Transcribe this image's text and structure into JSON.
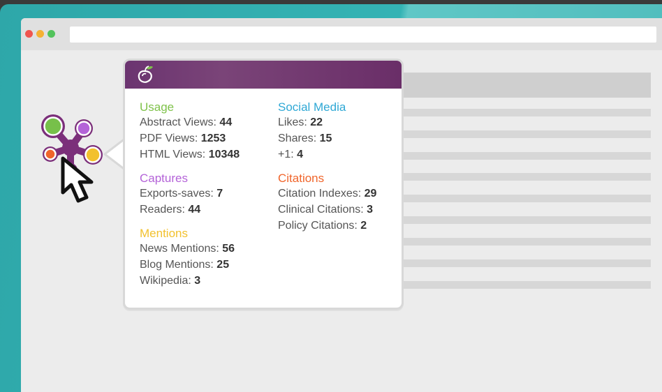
{
  "colors": {
    "usage": "#7fc24a",
    "social_media": "#2fa8d5",
    "captures": "#b463d8",
    "citations": "#f0652b",
    "mentions": "#f2c12e",
    "header_purple": "#6b3470",
    "frame_teal": "#34b3b4"
  },
  "icons": {
    "logo": "plum-logo-icon",
    "badge": "plumx-flower-icon",
    "cursor": "mouse-pointer-icon"
  },
  "popup": {
    "left_column": [
      {
        "title": "Usage",
        "color_key": "usage",
        "items": [
          {
            "label": "Abstract Views:",
            "value": "44"
          },
          {
            "label": "PDF Views:",
            "value": "1253"
          },
          {
            "label": "HTML Views:",
            "value": "10348"
          }
        ]
      },
      {
        "title": "Captures",
        "color_key": "captures",
        "items": [
          {
            "label": "Exports-saves:",
            "value": "7"
          },
          {
            "label": "Readers:",
            "value": "44"
          }
        ]
      },
      {
        "title": "Mentions",
        "color_key": "mentions",
        "items": [
          {
            "label": "News Mentions:",
            "value": "56"
          },
          {
            "label": "Blog Mentions:",
            "value": "25"
          },
          {
            "label": "Wikipedia:",
            "value": "3"
          }
        ]
      }
    ],
    "right_column": [
      {
        "title": "Social Media",
        "color_key": "social_media",
        "items": [
          {
            "label": "Likes:",
            "value": "22"
          },
          {
            "label": "Shares:",
            "value": "15"
          },
          {
            "label": "+1:",
            "value": "4"
          }
        ]
      },
      {
        "title": "Citations",
        "color_key": "citations",
        "items": [
          {
            "label": "Citation Indexes:",
            "value": "29"
          },
          {
            "label": "Clinical Citations:",
            "value": "3"
          },
          {
            "label": "Policy Citations:",
            "value": "2"
          }
        ]
      }
    ]
  }
}
